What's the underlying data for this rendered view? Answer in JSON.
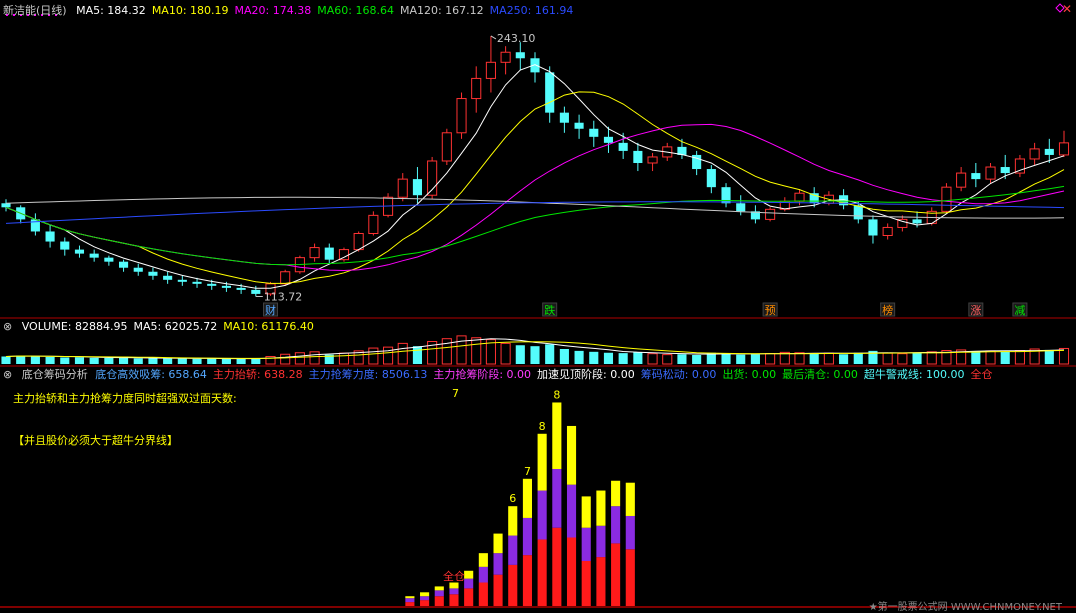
{
  "colors": {
    "up": "#ff3232",
    "down": "#54fcfc",
    "ma5": "#ffffff",
    "ma10": "#ffff00",
    "ma20": "#ff00ff",
    "ma60": "#00e600",
    "ma120": "#c8c8c8",
    "ma250": "#2b4bff",
    "divider": "#b00000"
  },
  "main": {
    "title": "新洁能(日线)",
    "indicators": [
      {
        "label": "MA5: 184.32",
        "color": "#ffffff"
      },
      {
        "label": "MA10: 180.19",
        "color": "#ffff00"
      },
      {
        "label": "MA20: 174.38",
        "color": "#ff00ff"
      },
      {
        "label": "MA60: 168.64",
        "color": "#00e600"
      },
      {
        "label": "MA120: 167.12",
        "color": "#c8c8c8"
      },
      {
        "label": "MA250: 161.94",
        "color": "#2b4bff"
      }
    ],
    "high_label": "243.10",
    "low_label": "113.72",
    "close_icon": "x-icon",
    "diamond_icon": "diamond-icon",
    "markers": [
      {
        "text": "财",
        "i": 18,
        "color": "#54a8ff"
      },
      {
        "text": "跌",
        "i": 37,
        "color": "#00e600"
      },
      {
        "text": "预",
        "i": 52,
        "color": "#ff8c00"
      },
      {
        "text": "榜",
        "i": 60,
        "color": "#ff8c00"
      },
      {
        "text": "涨",
        "i": 66,
        "color": "#ff6060"
      },
      {
        "text": "减",
        "i": 69,
        "color": "#00e600"
      }
    ]
  },
  "volume": {
    "indicators": [
      {
        "label": "VOLUME: 82884.95",
        "color": "#ffffff"
      },
      {
        "label": "MA5: 62025.72",
        "color": "#ffffff"
      },
      {
        "label": "MA10: 61176.40",
        "color": "#ffff00"
      }
    ]
  },
  "analysis": {
    "title": "底仓筹码分析",
    "indicators": [
      {
        "label": "底仓高效吸筹: 658.64",
        "color": "#54a8ff"
      },
      {
        "label": "主力抬轿: 638.28",
        "color": "#ff3232"
      },
      {
        "label": "主力抢筹力度: 8506.13",
        "color": "#3a6bff"
      },
      {
        "label": "主力抢筹阶段: 0.00",
        "color": "#ff3cff"
      },
      {
        "label": "加速见顶阶段: 0.00",
        "color": "#ffffff"
      },
      {
        "label": "筹码松动: 0.00",
        "color": "#3a6bff"
      },
      {
        "label": "出货: 0.00",
        "color": "#00e600"
      },
      {
        "label": "最后清仓: 0.00",
        "color": "#00e600"
      },
      {
        "label": "超牛警戒线: 100.00",
        "color": "#54fcfc"
      },
      {
        "label": "全仓",
        "color": "#ff3232"
      }
    ],
    "note1": "主力抬轿和主力抢筹力度同时超强双过面天数:",
    "note1_value": "7",
    "note2": "【并且股价必须大于超牛分界线】",
    "value_labels": [
      "8",
      "8",
      "7",
      "6"
    ],
    "overlay_label": "全仓",
    "watermark": "★第一股票公式网 WWW.CHNMONEY.NET"
  },
  "chart_data": [
    {
      "type": "candlestick",
      "title": "新洁能(日线)",
      "ylim": [
        108,
        252
      ],
      "ohlc": [
        [
          160,
          162,
          156,
          158
        ],
        [
          158,
          159,
          150,
          152
        ],
        [
          152,
          155,
          144,
          146
        ],
        [
          146,
          149,
          138,
          141
        ],
        [
          141,
          143,
          134,
          137
        ],
        [
          137,
          139,
          133,
          135
        ],
        [
          135,
          137,
          131,
          133
        ],
        [
          133,
          134,
          129,
          131
        ],
        [
          131,
          132,
          126,
          128
        ],
        [
          128,
          130,
          124,
          126
        ],
        [
          126,
          128,
          122,
          124
        ],
        [
          124,
          126,
          120,
          122
        ],
        [
          122,
          124,
          119,
          121
        ],
        [
          121,
          123,
          118,
          120
        ],
        [
          120,
          122,
          117,
          119
        ],
        [
          119,
          121,
          116,
          118
        ],
        [
          118,
          120,
          115,
          117
        ],
        [
          117,
          119,
          113.72,
          115
        ],
        [
          115,
          121,
          114,
          120
        ],
        [
          120,
          127,
          119,
          126
        ],
        [
          126,
          134,
          125,
          133
        ],
        [
          133,
          140,
          131,
          138
        ],
        [
          138,
          140,
          130,
          132
        ],
        [
          132,
          138,
          131,
          137
        ],
        [
          137,
          146,
          136,
          145
        ],
        [
          145,
          156,
          144,
          154
        ],
        [
          154,
          165,
          153,
          163
        ],
        [
          163,
          175,
          161,
          172
        ],
        [
          172,
          178,
          160,
          164
        ],
        [
          164,
          183,
          162,
          181
        ],
        [
          181,
          197,
          179,
          195
        ],
        [
          195,
          215,
          192,
          212
        ],
        [
          212,
          228,
          205,
          222
        ],
        [
          222,
          243.1,
          215,
          230
        ],
        [
          230,
          238,
          224,
          235
        ],
        [
          235,
          240,
          226,
          232
        ],
        [
          232,
          235,
          220,
          225
        ],
        [
          225,
          228,
          200,
          205
        ],
        [
          205,
          208,
          195,
          200
        ],
        [
          200,
          204,
          192,
          197
        ],
        [
          197,
          201,
          188,
          193
        ],
        [
          193,
          198,
          185,
          190
        ],
        [
          190,
          195,
          182,
          186
        ],
        [
          186,
          190,
          176,
          180
        ],
        [
          180,
          185,
          176,
          183
        ],
        [
          183,
          190,
          181,
          188
        ],
        [
          188,
          192,
          182,
          184
        ],
        [
          184,
          186,
          174,
          177
        ],
        [
          177,
          179,
          165,
          168
        ],
        [
          168,
          170,
          158,
          160
        ],
        [
          160,
          164,
          154,
          156
        ],
        [
          156,
          159,
          150,
          152
        ],
        [
          152,
          158,
          151,
          157
        ],
        [
          157,
          163,
          156,
          161
        ],
        [
          161,
          167,
          159,
          165
        ],
        [
          165,
          168,
          158,
          160
        ],
        [
          160,
          166,
          159,
          164
        ],
        [
          164,
          167,
          157,
          159
        ],
        [
          159,
          161,
          150,
          152
        ],
        [
          152,
          154,
          140,
          144
        ],
        [
          144,
          150,
          142,
          148
        ],
        [
          148,
          154,
          146,
          152
        ],
        [
          152,
          156,
          148,
          150
        ],
        [
          150,
          158,
          149,
          156
        ],
        [
          156,
          170,
          155,
          168
        ],
        [
          168,
          178,
          166,
          175
        ],
        [
          175,
          180,
          168,
          172
        ],
        [
          172,
          180,
          170,
          178
        ],
        [
          178,
          184,
          172,
          175
        ],
        [
          175,
          184,
          173,
          182
        ],
        [
          182,
          190,
          179,
          187
        ],
        [
          187,
          192,
          180,
          184
        ],
        [
          184,
          196,
          183,
          190
        ]
      ]
    },
    {
      "type": "bar",
      "title": "VOLUME",
      "ylim": [
        0,
        160000
      ],
      "values": [
        40000,
        45000,
        42000,
        38000,
        35000,
        36000,
        33000,
        32000,
        34000,
        30000,
        31000,
        29000,
        30000,
        28000,
        30000,
        27000,
        29000,
        31000,
        40000,
        52000,
        60000,
        65000,
        50000,
        58000,
        70000,
        85000,
        90000,
        110000,
        95000,
        120000,
        135000,
        150000,
        140000,
        130000,
        110000,
        100000,
        95000,
        105000,
        80000,
        70000,
        65000,
        60000,
        58000,
        62000,
        55000,
        50000,
        52000,
        48000,
        60000,
        58000,
        50000,
        52000,
        56000,
        62000,
        60000,
        55000,
        58000,
        52000,
        60000,
        70000,
        58000,
        55000,
        60000,
        65000,
        72000,
        75000,
        68000,
        70000,
        66000,
        72000,
        80000,
        75000,
        82885
      ]
    },
    {
      "type": "bar",
      "title": "底仓筹码分析",
      "ylim": [
        0,
        10
      ],
      "series": [
        {
          "name": "主力抬轿",
          "values": [
            0,
            0,
            0,
            0,
            0,
            0,
            0,
            0,
            0,
            0,
            0,
            0,
            0,
            0,
            0,
            0,
            0,
            0,
            0,
            0,
            0.2,
            0.3,
            0.5,
            0.6,
            0.9,
            1.2,
            1.6,
            2.1,
            2.6,
            3.4,
            4.0,
            3.5,
            2.3,
            2.5,
            3.2,
            2.9,
            0,
            0,
            0,
            0,
            0,
            0,
            0,
            0,
            0,
            0,
            0,
            0,
            0,
            0,
            0,
            0,
            0,
            0,
            0,
            0,
            0,
            0,
            0,
            0,
            0,
            0,
            0,
            0,
            0,
            0,
            0,
            0,
            0,
            0,
            0,
            0,
            0
          ]
        },
        {
          "name": "主力抢筹力度",
          "values": [
            0,
            0,
            0,
            0,
            0,
            0,
            0,
            0,
            0,
            0,
            0,
            0,
            0,
            0,
            0,
            0,
            0,
            0,
            0,
            0,
            0.2,
            0.2,
            0.3,
            0.3,
            0.5,
            0.8,
            1.1,
            1.5,
            1.9,
            2.5,
            3.0,
            2.7,
            1.7,
            1.6,
            1.9,
            1.7,
            0,
            0,
            0,
            0,
            0,
            0,
            0,
            0,
            0,
            0,
            0,
            0,
            0,
            0,
            0,
            0,
            0,
            0,
            0,
            0,
            0,
            0,
            0,
            0,
            0,
            0,
            0,
            0,
            0,
            0,
            0,
            0,
            0,
            0,
            0,
            0,
            0
          ]
        },
        {
          "name": "超强",
          "values": [
            0,
            0,
            0,
            0,
            0,
            0,
            0,
            0,
            0,
            0,
            0,
            0,
            0,
            0,
            0,
            0,
            0,
            0,
            0,
            0,
            0.1,
            0.2,
            0.2,
            0.3,
            0.4,
            0.7,
            1.0,
            1.5,
            2.0,
            2.9,
            3.4,
            3.0,
            1.6,
            1.8,
            1.3,
            1.7,
            0,
            0,
            0,
            0,
            0,
            0,
            0,
            0,
            0,
            0,
            0,
            0,
            0,
            0,
            0,
            0,
            0,
            0,
            0,
            0,
            0,
            0,
            0,
            0,
            0,
            0,
            0,
            0,
            0,
            0,
            0,
            0,
            0,
            0,
            0,
            0,
            0
          ]
        }
      ]
    }
  ]
}
